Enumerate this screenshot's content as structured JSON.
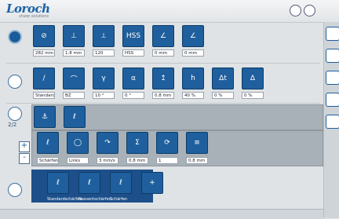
{
  "header": {
    "logo": "Loroch",
    "tagline": "sharp solutions"
  },
  "rows": {
    "row1_values": [
      "282 mm",
      "1.8 mm",
      "120",
      "HSS",
      "0 mm",
      "0 mm"
    ],
    "row2_values": [
      "Standard",
      "BZ",
      "10 °",
      "0 °",
      "0.8 mm",
      "40 %",
      "0 %",
      "0 %"
    ],
    "row3_counter": "2/2",
    "row4_values": [
      "Schärfen",
      "Links",
      "3 mm/s",
      "0.8 mm",
      "1",
      "0.8 mm"
    ],
    "row5_labels": [
      "Standardschärfen",
      "Nassentschärfen",
      "Schärfen"
    ]
  },
  "tiles": {
    "row1": [
      "⊘",
      "⊥",
      "⟂",
      "HSS",
      "∠",
      "∠"
    ],
    "row2": [
      "/",
      "⌒",
      "γ",
      "α",
      "↥",
      "h",
      "Δt",
      "Δ"
    ],
    "row3": [
      "⚓",
      "ℓ"
    ],
    "row4": [
      "ℓ",
      "◯",
      "↷",
      "Σ",
      "⟳",
      "≡"
    ],
    "row5": [
      "ℓ",
      "ℓ",
      "ℓ",
      "+"
    ]
  },
  "controls": {
    "plus": "+",
    "minus": "-"
  }
}
